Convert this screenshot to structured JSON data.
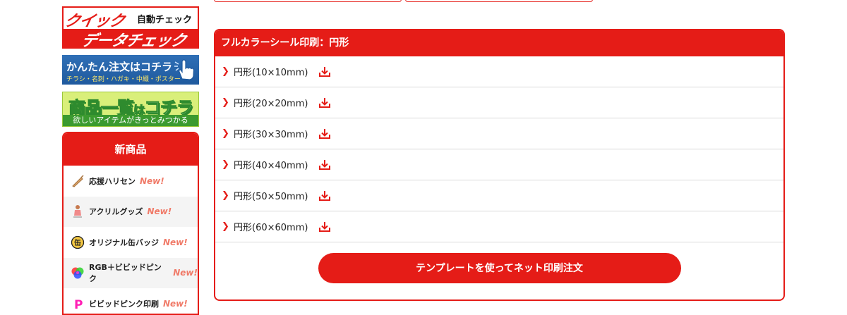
{
  "sidebar": {
    "banner_quick": {
      "top_left": "クイック",
      "top_right": "自動チェック",
      "bottom": "データチェック"
    },
    "banner_order": {
      "main": "かんたん注文はコチラ",
      "sub": "チラシ・名刺・ハガキ・中綴・ポスター"
    },
    "banner_items": {
      "main_1": "商品一覧",
      "main_small": "は",
      "main_2": "コチラ",
      "sub": "欲しいアイテムがきっとみつかる"
    },
    "new_products": {
      "title": "新商品",
      "new_tag": "New!",
      "items": [
        {
          "label": "応援ハリセン",
          "icon": "fan-icon"
        },
        {
          "label": "アクリルグッズ",
          "icon": "acrylic-figure-icon"
        },
        {
          "label": "オリジナル缶バッジ",
          "icon": "can-badge-icon"
        },
        {
          "label": "RGB＋ビビッドピンク",
          "icon": "rgb-circles-icon"
        },
        {
          "label": "ビビッドピンク印刷",
          "icon": "letter-p-icon"
        }
      ]
    }
  },
  "panel": {
    "title": "フルカラーシール印刷：円形",
    "rows": [
      {
        "label": "円形(10×10mm)"
      },
      {
        "label": "円形(20×20mm)"
      },
      {
        "label": "円形(30×30mm)"
      },
      {
        "label": "円形(40×40mm)"
      },
      {
        "label": "円形(50×50mm)"
      },
      {
        "label": "円形(60×60mm)"
      }
    ],
    "cta_label": "テンプレートを使ってネット印刷注文"
  },
  "colors": {
    "accent": "#e51c17",
    "new_tag": "#f07a68",
    "order_banner": "#2f6fb6",
    "items_banner": "#d9ef7a"
  },
  "icons": {
    "chevron": "chevron-right-icon",
    "download": "download-icon",
    "hand": "pointing-hand-icon"
  }
}
